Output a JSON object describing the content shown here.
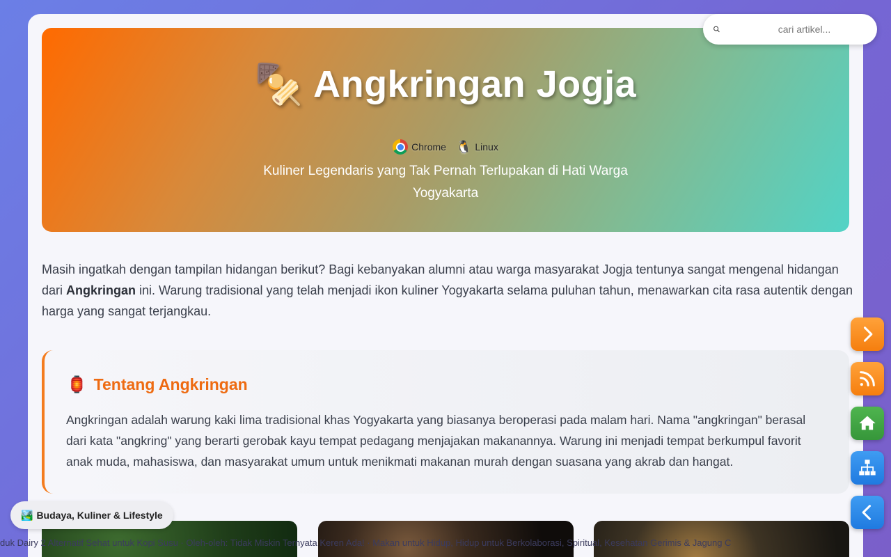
{
  "search": {
    "placeholder": "cari artikel..."
  },
  "hero": {
    "emoji": "🍢",
    "title": "Angkringan Jogja",
    "badges": [
      {
        "label": "Chrome",
        "icon": "chrome-icon"
      },
      {
        "label": "Linux",
        "icon": "linux-penguin-icon"
      }
    ],
    "subtitle": "Kuliner Legendaris yang Tak Pernah Terlupakan di Hati Warga Yogyakarta"
  },
  "intro": {
    "before_bold": "Masih ingatkah dengan tampilan hidangan berikut? Bagi kebanyakan alumni atau warga masyarakat Jogja tentunya sangat mengenal hidangan dari ",
    "bold": "Angkringan",
    "after_bold": " ini. Warung tradisional yang telah menjadi ikon kuliner Yogyakarta selama puluhan tahun, menawarkan cita rasa autentik dengan harga yang sangat terjangkau."
  },
  "about": {
    "emoji": "🏮",
    "title": "Tentang Angkringan",
    "text": "Angkringan adalah warung kaki lima tradisional khas Yogyakarta yang biasanya beroperasi pada malam hari. Nama \"angkringan\" berasal dari kata \"angkring\" yang berarti gerobak kayu tempat pedagang menjajakan makanannya. Warung ini menjadi tempat berkumpul favorit anak muda, mahasiswa, dan masyarakat umum untuk menikmati makanan murah dengan suasana yang akrab dan hangat."
  },
  "category": {
    "emoji": "🏞️",
    "label": "Budaya, Kuliner & Lifestyle"
  },
  "ticker": "duk Dairy 2 Alternatif Sehat untuk Kopi Susu   ·   Oleh-oleh: Tidak Miskin Ternyata Keren Ada!   ·   Makan untuk Hidup, Hidup untuk Berkolaborasi, Spiritual, Kesehatan Gerimis & Jagung C",
  "fab": [
    {
      "icon": "chevron-right-icon",
      "color": "#f57e0e"
    },
    {
      "icon": "rss-icon",
      "color": "#f57e0e"
    },
    {
      "icon": "home-icon",
      "color": "#36963a"
    },
    {
      "icon": "sitemap-icon",
      "color": "#1f7ae0"
    },
    {
      "icon": "chevron-left-icon",
      "color": "#1f7ae0"
    }
  ]
}
